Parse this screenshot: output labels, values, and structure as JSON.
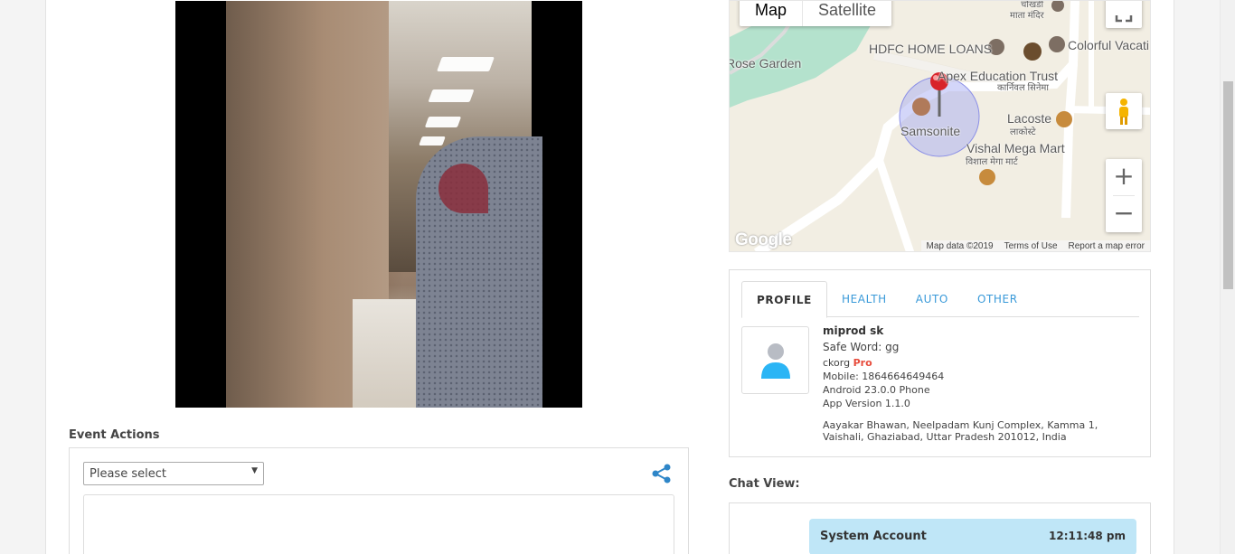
{
  "event_actions": {
    "title": "Event Actions",
    "select_value": "Please select"
  },
  "map": {
    "type_buttons": {
      "map": "Map",
      "satellite": "Satellite"
    },
    "places": {
      "rose_garden": "Rose Garden",
      "hdfc": "HDFC HOME LOANS",
      "colorful": "Colorful Vacati",
      "apex": "Apex Education Trust",
      "carnival_hi": "कार्निवल सिनेमा",
      "mata_mandir_top": "चौखंडी",
      "mata_mandir": "माता मंदिर",
      "samsonite": "Samsonite",
      "lacoste": "Lacoste",
      "lacoste_hi": "लाकोस्टे",
      "vishal": "Vishal Mega Mart",
      "vishal_hi": "विशाल मेगा मार्ट"
    },
    "logo": "Google",
    "attribution": {
      "data": "Map data ©2019",
      "terms": "Terms of Use",
      "report": "Report a map error"
    },
    "zoom_in": "+",
    "zoom_out": "−"
  },
  "profile": {
    "tabs": [
      "PROFILE",
      "HEALTH",
      "AUTO",
      "OTHER"
    ],
    "name": "miprod sk",
    "safe_word": "Safe Word: gg",
    "org": "ckorg",
    "org_badge": "Pro",
    "mobile": "Mobile: 1864664649464",
    "device": "Android 23.0.0 Phone",
    "app_version": "App Version 1.1.0",
    "address": "Aayakar Bhawan, Neelpadam Kunj Complex, Kamma 1, Vaishali, Ghaziabad, Uttar Pradesh 201012, India"
  },
  "chat": {
    "title": "Chat View:",
    "messages": [
      {
        "sender": "System Account",
        "time": "12:11:48 pm"
      }
    ]
  },
  "colors": {
    "accent": "#3a9ad9",
    "pro": "#e74c3c",
    "chat_bubble": "#bfe6f7"
  }
}
